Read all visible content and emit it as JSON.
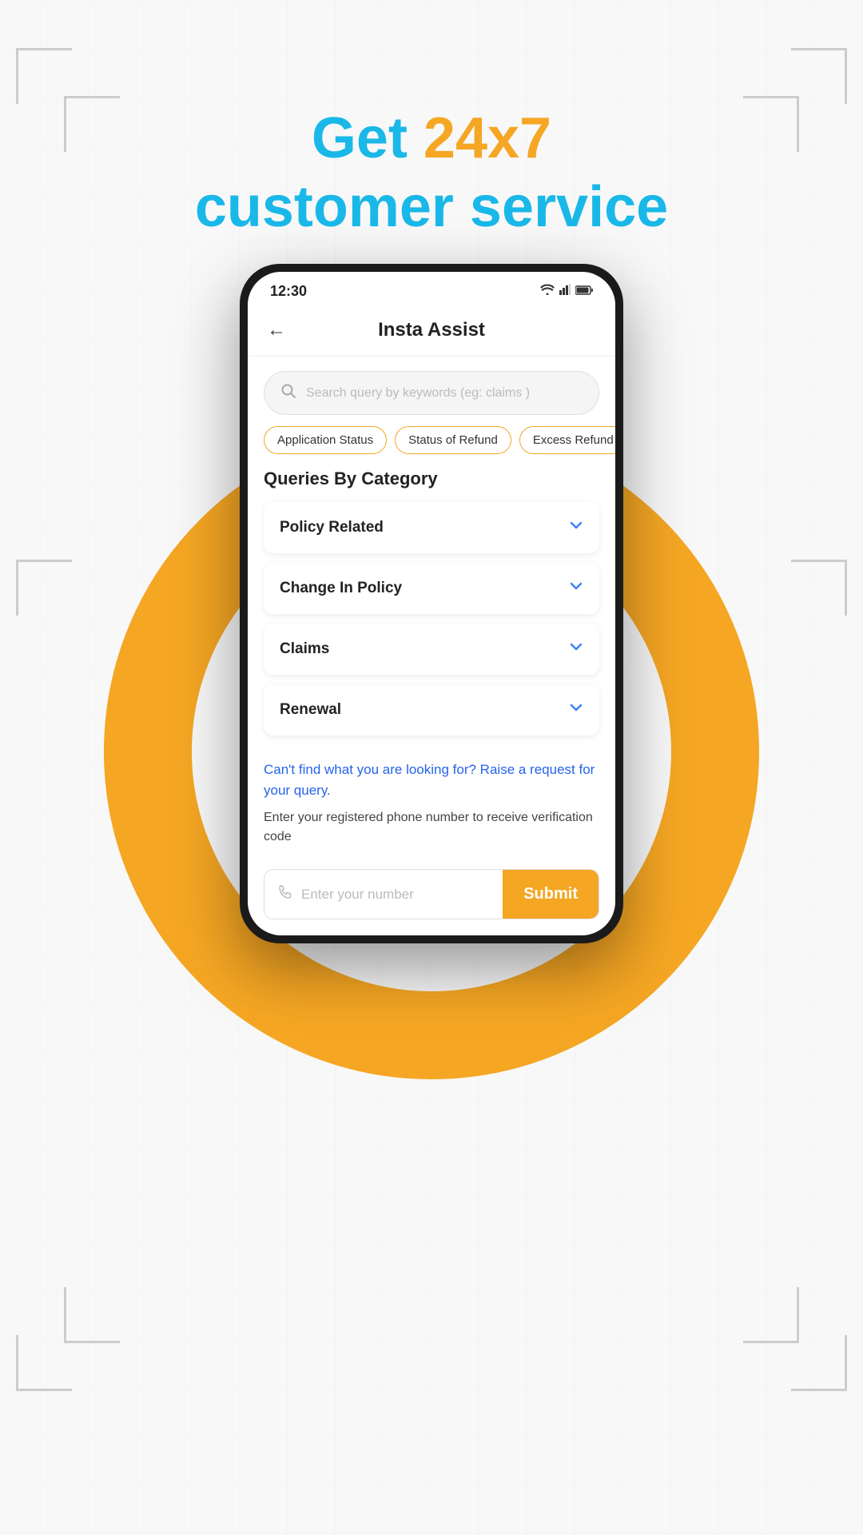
{
  "page": {
    "background_color": "#f8f8f8",
    "accent_color": "#f5a623",
    "primary_color": "#1ab8e8"
  },
  "header": {
    "line1_prefix": "Get ",
    "line1_highlight": "24x7",
    "line2": "customer service"
  },
  "phone": {
    "status_bar": {
      "time": "12:30",
      "wifi": "▼",
      "signal": "▲",
      "battery": "▮"
    },
    "app_bar": {
      "title": "Insta Assist",
      "back_label": "←"
    },
    "search": {
      "placeholder": "Search query by keywords (eg: claims )"
    },
    "tags": [
      "Application Status",
      "Status of Refund",
      "Excess Refund"
    ],
    "queries_section_title": "Queries By Category",
    "accordion_items": [
      {
        "label": "Policy Related"
      },
      {
        "label": "Change In Policy"
      },
      {
        "label": "Claims"
      },
      {
        "label": "Renewal"
      }
    ],
    "cant_find": {
      "link_text": "Can't find what you are looking for? Raise a request for your query.",
      "description": "Enter your registered phone number to receive verification code"
    },
    "phone_input": {
      "placeholder": "Enter your number",
      "submit_label": "Submit"
    }
  }
}
